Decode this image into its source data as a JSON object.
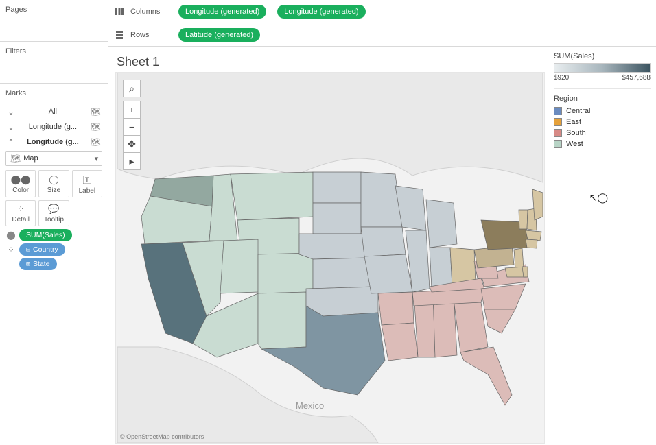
{
  "left": {
    "pages_title": "Pages",
    "filters_title": "Filters",
    "marks_title": "Marks",
    "mark_rows": {
      "all": "All",
      "lon1": "Longitude (g...",
      "lon2": "Longitude (g..."
    },
    "mark_type": "Map",
    "cells": {
      "color": "Color",
      "size": "Size",
      "label": "Label",
      "detail": "Detail",
      "tooltip": "Tooltip"
    },
    "dims": {
      "sum_sales": "SUM(Sales)",
      "country": "Country",
      "state": "State"
    }
  },
  "shelves": {
    "columns_label": "Columns",
    "rows_label": "Rows",
    "longitude": "Longitude (generated)",
    "latitude": "Latitude (generated)"
  },
  "sheet": {
    "title": "Sheet 1"
  },
  "map": {
    "attribution": "© OpenStreetMap contributors",
    "mexico_label": "Mexico"
  },
  "legend": {
    "color_title": "SUM(Sales)",
    "grad_min": "$920",
    "grad_max": "$457,688",
    "region_title": "Region",
    "regions": {
      "central": "Central",
      "east": "East",
      "south": "South",
      "west": "West"
    }
  },
  "colors": {
    "central": "#6a8bbf",
    "east": "#e5a13a",
    "south": "#d78a86",
    "west": "#b8d4c6"
  }
}
